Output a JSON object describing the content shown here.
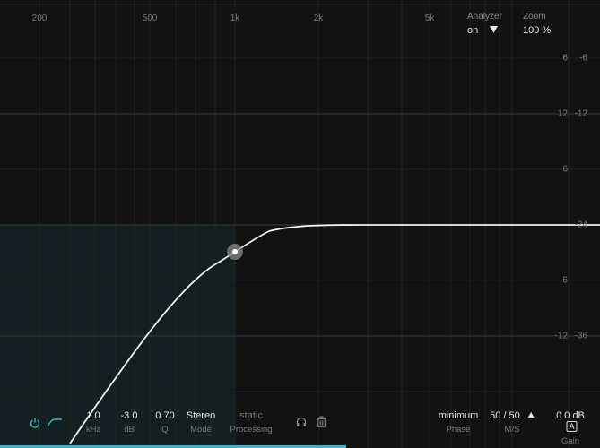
{
  "freq_labels": [
    "200",
    "500",
    "1k",
    "2k",
    "5k"
  ],
  "gain_labels_left": [
    "6",
    "12",
    "6",
    "-6",
    "-12"
  ],
  "gain_labels_right": [
    "-6",
    "-12",
    "-24",
    "-36"
  ],
  "analyzer": {
    "title": "Analyzer",
    "value": "on"
  },
  "zoom": {
    "title": "Zoom",
    "value": "100 %"
  },
  "band": {
    "frequency": "1.0",
    "frequency_unit": "kHz",
    "gain": "-3.0",
    "gain_unit": "dB",
    "q": "0.70",
    "q_unit": "Q",
    "mode": "Stereo",
    "mode_unit": "Mode",
    "processing": "static",
    "processing_unit": "Processing"
  },
  "output": {
    "phase": "minimum",
    "phase_unit": "Phase",
    "ms": "50 / 50",
    "ms_unit": "M/S",
    "gain": "0.0 dB",
    "gain_unit": "Gain",
    "auto_badge": "A"
  },
  "colors": {
    "accent": "#3cb4c8",
    "background": "#121212",
    "curve": "#f2f2f2"
  },
  "icons": [
    "power-icon",
    "highpass-shape-icon",
    "headphones-icon",
    "trash-icon",
    "triangle-down-icon",
    "triangle-up-icon"
  ]
}
